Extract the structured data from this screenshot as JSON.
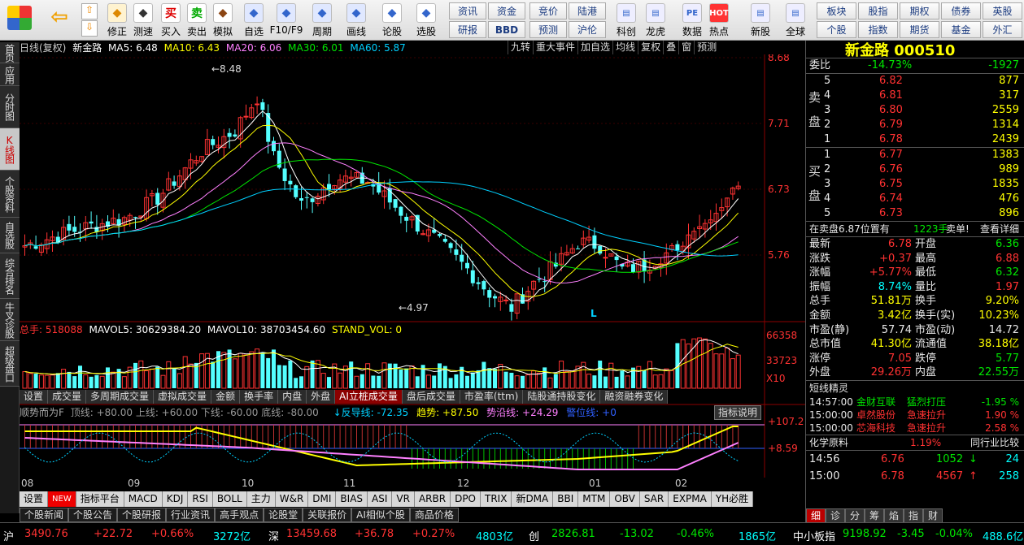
{
  "toolbar": {
    "left_buttons": [
      {
        "label": "修正",
        "icon": "coin-icon"
      },
      {
        "label": "测速",
        "icon": "clock-icon"
      },
      {
        "label": "买入",
        "icon": "buy-icon",
        "glyph": "买"
      },
      {
        "label": "卖出",
        "icon": "sell-icon",
        "glyph": "卖"
      },
      {
        "label": "模拟",
        "icon": "hammer-icon"
      },
      {
        "label": "自选",
        "icon": "star-icon"
      },
      {
        "label": "F10/F9",
        "icon": "report-icon"
      },
      {
        "label": "周期",
        "icon": "period-icon"
      },
      {
        "label": "画线",
        "icon": "draw-icon"
      },
      {
        "label": "论股",
        "icon": "discuss-icon"
      },
      {
        "label": "选股",
        "icon": "select-icon"
      }
    ],
    "grid1": [
      "资讯",
      "资金",
      "研报",
      "BBD"
    ],
    "grid2": [
      "竞价",
      "陆港",
      "预测",
      "沪伦"
    ],
    "mid_buttons": [
      {
        "label": "科创",
        "icon": "kechuang-icon"
      },
      {
        "label": "龙虎",
        "icon": "dragon-icon"
      },
      {
        "label": "数据",
        "icon": "data-icon",
        "glyph": "PE"
      },
      {
        "label": "热点",
        "icon": "hot-icon",
        "glyph": "HOT"
      },
      {
        "label": "新股",
        "icon": "newstock-icon"
      },
      {
        "label": "全球",
        "icon": "globe-icon"
      }
    ],
    "grid3": [
      "板块",
      "股指",
      "期权",
      "债券",
      "英股",
      "个股",
      "指数",
      "期货",
      "基金",
      "外汇"
    ]
  },
  "left_tabs": [
    "首页",
    "应用",
    "分时图",
    "K线图",
    "个股资料",
    "自选股",
    "综合排名",
    "牛叉诊股",
    "超级盘口"
  ],
  "left_tab_active": 3,
  "chart_header": {
    "title": "日线(复权)",
    "stock": "新金路",
    "ma5": "MA5: 6.48",
    "ma10": "MA10: 6.43",
    "ma20": "MA20: 6.06",
    "ma30": "MA30: 6.01",
    "ma60": "MA60: 5.87"
  },
  "chart_tools": [
    "九转",
    "重大事件",
    "加自选",
    "均线",
    "复权",
    "叠",
    "窗",
    "预测"
  ],
  "vol_header": {
    "total": "总手: 518088",
    "mavol5": "MAVOL5: 30629384.20",
    "mavol10": "MAVOL10: 38703454.60",
    "std": "STAND_VOL: 0"
  },
  "vol_tabs": [
    "设置",
    "成交量",
    "多周期成交量",
    "虚拟成交量",
    "金额",
    "换手率",
    "内盘",
    "外盘",
    "AI立桩成交量",
    "盘后成交量",
    "市盈率(ttm)",
    "陆股通持股变化",
    "融资融券变化"
  ],
  "vol_tab_active": 8,
  "ind_header": {
    "name": "顺势而为F",
    "lines": "顶线: +80.00  上线: +60.00  下线: -60.00  底线: -80.00",
    "fandao": "↓反导线: -72.35",
    "trend": "趋势: +87.50",
    "shiyan": "势沿线: +24.29",
    "baowei": "警位线: +0",
    "help": "指标说明"
  },
  "price_axis": [
    "8.68",
    "7.71",
    "6.73",
    "5.76"
  ],
  "vol_axis": [
    "66358",
    "33723",
    "X10"
  ],
  "ind_axis": [
    "+107.2",
    "+8.59"
  ],
  "annotations": {
    "high": "8.48",
    "low": "4.97",
    "marker": "L"
  },
  "x_labels": [
    "08",
    "09",
    "10",
    "11",
    "12",
    "01",
    "02"
  ],
  "indicator_tabs": [
    "设置",
    "NEW",
    "指标平台",
    "MACD",
    "KDJ",
    "RSI",
    "BOLL",
    "主力",
    "W&R",
    "DMI",
    "BIAS",
    "ASI",
    "VR",
    "ARBR",
    "DPO",
    "TRIX",
    "新DMA",
    "BBI",
    "MTM",
    "OBV",
    "SAR",
    "EXPMA",
    "YH必胜"
  ],
  "news_tabs": [
    "个股新闻",
    "个股公告",
    "个股研报",
    "行业资讯",
    "高手观点",
    "论股堂",
    "关联报价",
    "AI相似个股",
    "商品价格"
  ],
  "quote": {
    "name": "新金路 000510",
    "weibi": {
      "label": "委比",
      "value": "-14.73%",
      "diff": "-1927"
    },
    "sell": [
      {
        "n": "5",
        "price": "6.82",
        "vol": "877"
      },
      {
        "n": "4",
        "price": "6.81",
        "vol": "317"
      },
      {
        "n": "3",
        "price": "6.80",
        "vol": "2559"
      },
      {
        "n": "2",
        "price": "6.79",
        "vol": "1314"
      },
      {
        "n": "1",
        "price": "6.78",
        "vol": "2439"
      }
    ],
    "sell_label": "卖盘",
    "buy": [
      {
        "n": "1",
        "price": "6.77",
        "vol": "1383"
      },
      {
        "n": "2",
        "price": "6.76",
        "vol": "989"
      },
      {
        "n": "3",
        "price": "6.75",
        "vol": "1835"
      },
      {
        "n": "4",
        "price": "6.74",
        "vol": "476"
      },
      {
        "n": "5",
        "price": "6.73",
        "vol": "896"
      }
    ],
    "buy_label": "买盘",
    "order_note": "在卖盘6.87位置有",
    "order_vol": "1223手",
    "order_type": "卖单!",
    "order_link": "查看详细",
    "stats": [
      {
        "l1": "最新",
        "v1": "6.78",
        "c1": "red",
        "l2": "开盘",
        "v2": "6.36",
        "c2": "green"
      },
      {
        "l1": "涨跌",
        "v1": "+0.37",
        "c1": "red",
        "l2": "最高",
        "v2": "6.88",
        "c2": "red"
      },
      {
        "l1": "涨幅",
        "v1": "+5.77%",
        "c1": "red",
        "l2": "最低",
        "v2": "6.32",
        "c2": "green"
      },
      {
        "l1": "振幅",
        "v1": "8.74%",
        "c1": "cyan",
        "l2": "量比",
        "v2": "1.97",
        "c2": "red"
      },
      {
        "l1": "总手",
        "v1": "51.81万",
        "c1": "yellow",
        "l2": "换手",
        "v2": "9.20%",
        "c2": "yellow"
      },
      {
        "l1": "金额",
        "v1": "3.42亿",
        "c1": "yellow",
        "l2": "换手(实)",
        "v2": "10.23%",
        "c2": "yellow"
      },
      {
        "l1": "市盈(静)",
        "v1": "57.74",
        "c1": "white",
        "l2": "市盈(动)",
        "v2": "14.72",
        "c2": "white"
      },
      {
        "l1": "总市值",
        "v1": "41.30亿",
        "c1": "yellow",
        "l2": "流通值",
        "v2": "38.18亿",
        "c2": "yellow"
      },
      {
        "l1": "涨停",
        "v1": "7.05",
        "c1": "red",
        "l2": "跌停",
        "v2": "5.77",
        "c2": "green"
      },
      {
        "l1": "外盘",
        "v1": "29.26万",
        "c1": "red",
        "l2": "内盘",
        "v2": "22.55万",
        "c2": "green"
      }
    ],
    "short_title": "短线精灵",
    "short": [
      {
        "t": "14:57:00",
        "name": "金财互联",
        "act": "猛烈打压",
        "chg": "-1.95 %",
        "c": "green"
      },
      {
        "t": "15:00:00",
        "name": "卓然股份",
        "act": "急速拉升",
        "chg": "1.90 %",
        "c": "red"
      },
      {
        "t": "15:00:00",
        "name": "芯海科技",
        "act": "急速拉升",
        "chg": "2.58 %",
        "c": "red"
      }
    ],
    "industry": "化学原料",
    "industry_chg": "1.19%",
    "industry_btn": "同行业比较",
    "ticks": [
      {
        "t": "14:56",
        "p": "6.76",
        "v": "1052",
        "dir": "↓",
        "n": "24"
      },
      {
        "t": "15:00",
        "p": "6.78",
        "v": "4567",
        "dir": "↑",
        "n": "258"
      }
    ],
    "bottom_tabs": [
      "细",
      "诊",
      "分",
      "筹",
      "焰",
      "指",
      "财"
    ]
  },
  "status": {
    "sh_label": "沪",
    "sh": "3490.76",
    "sh_chg": "+22.72",
    "sh_pct": "+0.66%",
    "sh_amt": "3272亿",
    "sz_label": "深",
    "sz": "13459.68",
    "sz_chg": "+36.78",
    "sz_pct": "+0.27%",
    "sz_amt": "4803亿",
    "cy_label": "创",
    "cy": "2826.81",
    "cy_chg": "-13.02",
    "cy_pct": "-0.46%",
    "cy_amt": "1865亿",
    "zx_label": "中小板指",
    "zx": "9198.92",
    "zx_chg": "-3.45",
    "zx_pct": "-0.04%",
    "zx_amt": "488.6亿"
  }
}
